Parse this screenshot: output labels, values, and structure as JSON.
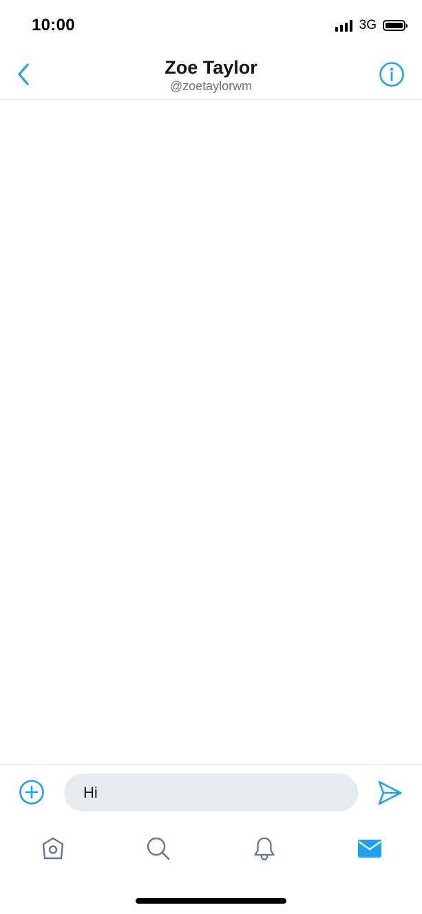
{
  "status_bar": {
    "time": "10:00",
    "network": "3G",
    "icons": [
      "signal-icon",
      "battery-icon"
    ]
  },
  "header": {
    "title": "Zoe Taylor",
    "handle": "@zoetaylorwm",
    "icons": [
      "back-chevron-icon",
      "info-icon"
    ]
  },
  "composer": {
    "input_value": "Hi",
    "icons": [
      "add-media-icon",
      "send-icon"
    ]
  },
  "tab_bar": {
    "tabs": [
      {
        "icon": "home-icon",
        "active": false
      },
      {
        "icon": "search-icon",
        "active": false
      },
      {
        "icon": "notifications-bell-icon",
        "active": false
      },
      {
        "icon": "messages-envelope-icon",
        "active": true
      }
    ]
  },
  "colors": {
    "accent": "#1da1f2",
    "inactive_icon": "#657786",
    "input_background": "#e6ecf0",
    "divider": "#e1e8ed",
    "text_primary": "#14171a",
    "text_secondary": "#657786"
  }
}
